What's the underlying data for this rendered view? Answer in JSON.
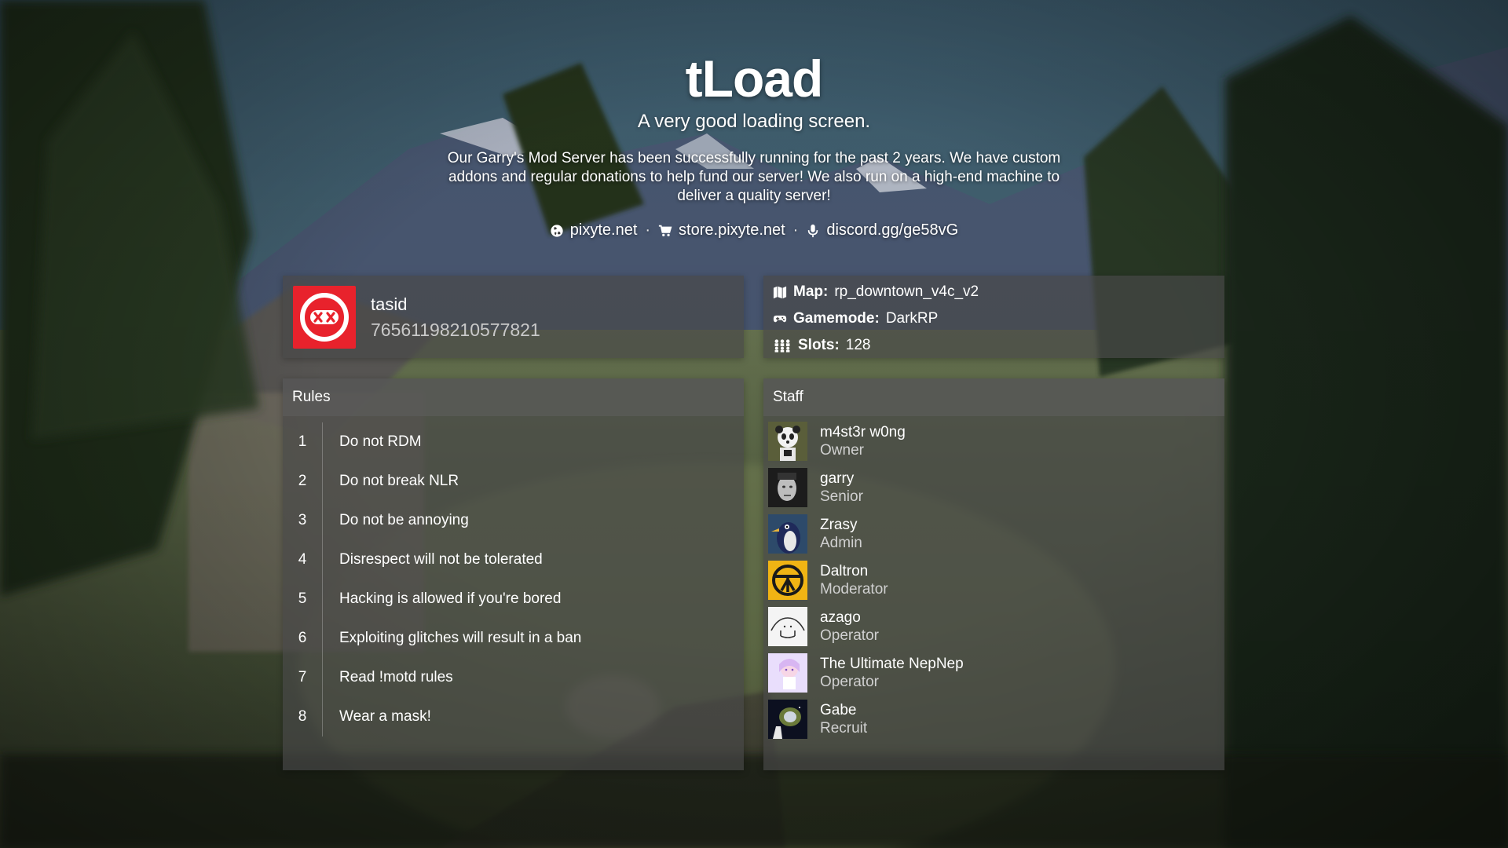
{
  "header": {
    "title": "tLoad",
    "subtitle": "A very good loading screen.",
    "description": "Our Garry's Mod Server has been successfully running for the past 2 years. We have custom addons and regular donations to help fund our server! We also run on a high-end machine to deliver a quality server!",
    "links": [
      {
        "icon": "globe-icon",
        "text": "pixyte.net"
      },
      {
        "icon": "cart-icon",
        "text": "store.pixyte.net"
      },
      {
        "icon": "microphone-icon",
        "text": "discord.gg/ge58vG"
      }
    ],
    "separator": "·"
  },
  "player": {
    "name": "tasid",
    "steam_id": "76561198210577821",
    "avatar_color": "#e8222c"
  },
  "server": {
    "map_label": "Map:",
    "map": "rp_downtown_v4c_v2",
    "gamemode_label": "Gamemode:",
    "gamemode": "DarkRP",
    "slots_label": "Slots:",
    "slots": "128"
  },
  "rules": {
    "title": "Rules",
    "items": [
      {
        "num": "1",
        "text": "Do not RDM"
      },
      {
        "num": "2",
        "text": "Do not break NLR"
      },
      {
        "num": "3",
        "text": "Do not be annoying"
      },
      {
        "num": "4",
        "text": "Disrespect will not be tolerated"
      },
      {
        "num": "5",
        "text": "Hacking is allowed if you're bored"
      },
      {
        "num": "6",
        "text": "Exploiting glitches will result in a ban"
      },
      {
        "num": "7",
        "text": "Read !motd rules"
      },
      {
        "num": "8",
        "text": "Wear a mask!"
      }
    ]
  },
  "staff": {
    "title": "Staff",
    "members": [
      {
        "name": "m4st3r w0ng",
        "rank": "Owner",
        "avatar": "panda-avatar"
      },
      {
        "name": "garry",
        "rank": "Senior",
        "avatar": "face-photo-avatar"
      },
      {
        "name": "Zrasy",
        "rank": "Admin",
        "avatar": "penguin-avatar"
      },
      {
        "name": "Daltron",
        "rank": "Moderator",
        "avatar": "yellow-emblem-avatar"
      },
      {
        "name": "azago",
        "rank": "Operator",
        "avatar": "sketch-avatar"
      },
      {
        "name": "The Ultimate NepNep",
        "rank": "Operator",
        "avatar": "anime-avatar"
      },
      {
        "name": "Gabe",
        "rank": "Recruit",
        "avatar": "space-avatar"
      }
    ]
  }
}
